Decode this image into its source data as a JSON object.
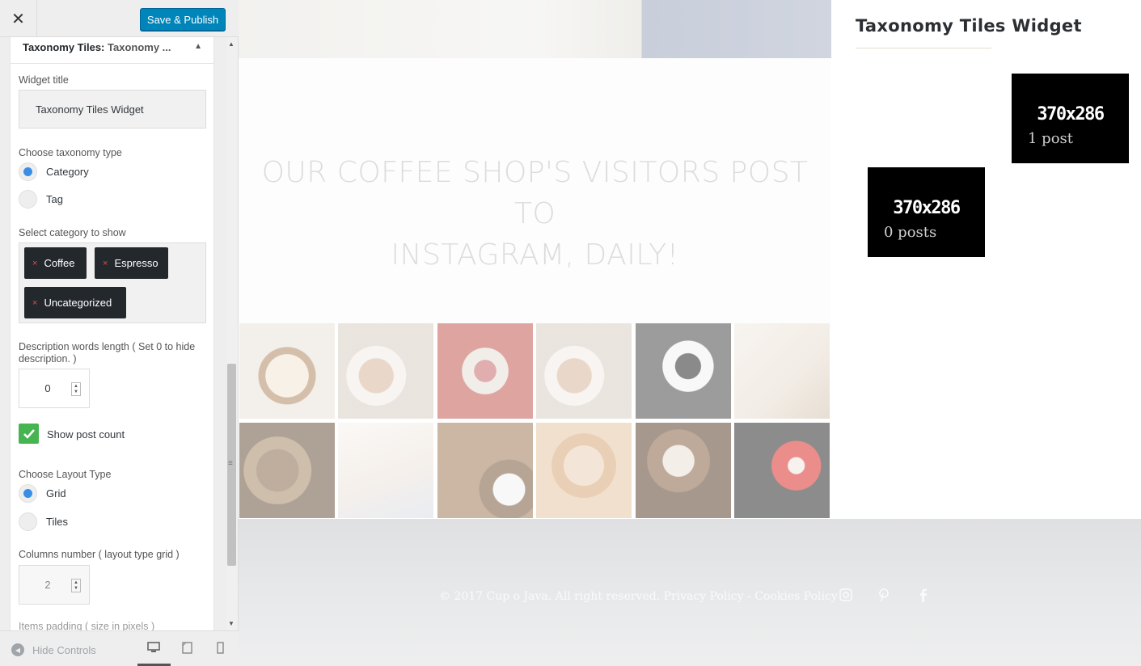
{
  "toolbar": {
    "close_label": "✕",
    "save_label": "Save & Publish"
  },
  "widget": {
    "header_title": "Taxonomy Tiles:",
    "header_subtitle": "Taxonomy ...",
    "toggle_icon": "▲"
  },
  "form": {
    "title_label": "Widget title",
    "title_value": "Taxonomy Tiles Widget",
    "taxonomy_label": "Choose taxonomy type",
    "taxonomy_options": [
      {
        "label": "Category",
        "checked": true
      },
      {
        "label": "Tag",
        "checked": false
      }
    ],
    "category_label": "Select category to show",
    "categories": [
      "Coffee",
      "Espresso",
      "Uncategorized"
    ],
    "chip_remove": "×",
    "desc_label_1": "Description words length ( Set 0 to hide",
    "desc_label_2": "description. )",
    "desc_value": "0",
    "postcount_label": "Show post count",
    "postcount_checked": true,
    "layout_label": "Choose Layout Type",
    "layout_options": [
      {
        "label": "Grid",
        "checked": true
      },
      {
        "label": "Tiles",
        "checked": false
      }
    ],
    "columns_label": "Columns number ( layout type grid )",
    "columns_value": "2",
    "padding_label": "Items padding ( size in pixels )"
  },
  "footer_controls": {
    "hide_label": "Hide Controls"
  },
  "preview": {
    "hero_heading_1": "OUR COFFEE SHOP'S VISITORS POST TO",
    "hero_heading_2": "INSTAGRAM, DAILY!",
    "widget_title": "Taxonomy Tiles Widget",
    "tiles": [
      {
        "size": "370x286",
        "count": "1 post"
      },
      {
        "size": "370x286",
        "count": "0 posts"
      }
    ],
    "copyright": "© 2017 Cup o Java. All right reserved.",
    "privacy": "Privacy Policy",
    "separator": "-",
    "cookies": "Cookies Policy"
  },
  "colors": {
    "primary_button": "#0085ba",
    "radio_selected": "#3a8ee6",
    "checkbox": "#46b450",
    "chip": "#23282d",
    "tile": "#000000"
  },
  "icons": [
    "close-icon",
    "collapse-arrow-icon",
    "radio-icon",
    "remove-chip-icon",
    "spinner-icon",
    "checkmark-icon",
    "hide-controls-icon",
    "desktop-icon",
    "tablet-icon",
    "mobile-icon",
    "instagram-icon",
    "pinterest-icon",
    "facebook-icon"
  ]
}
